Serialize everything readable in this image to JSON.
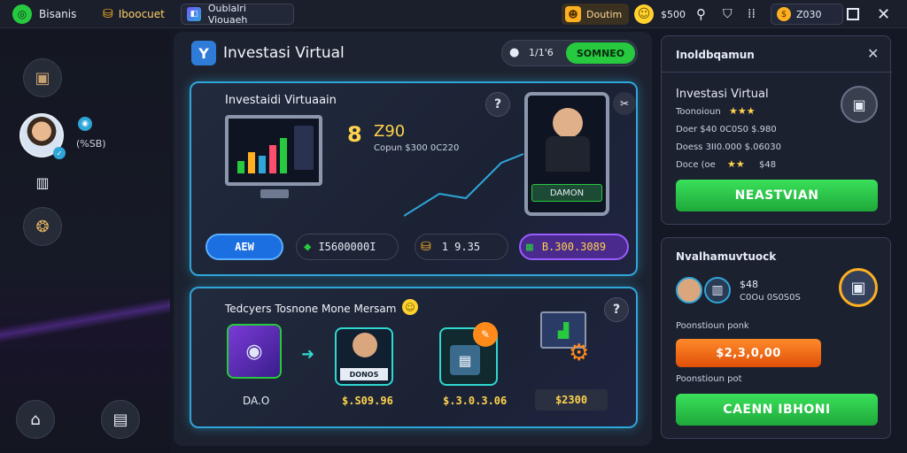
{
  "topbar": {
    "brand_label": "Bisanis",
    "tab2_label": "Iboocuet",
    "window_label": "Oublalri Viouaeh",
    "coin_label": "Doutim",
    "stat_value": "$500",
    "gold_value": "Z030"
  },
  "sidebar": {
    "user_stat": "(%SB)"
  },
  "header": {
    "title": "Investasi Virtual",
    "counter": "1/1'6",
    "status_label": "SOMNEO"
  },
  "featured": {
    "title": "Investaidi Virtuaain",
    "score": "Z90",
    "sub": "Copun $300 0C220",
    "card_label": "DAMON",
    "actions": {
      "add_label": "AEW",
      "balance": "I5600000I",
      "coins": "1 9.35",
      "total": "B.300.3089"
    }
  },
  "market": {
    "title": "Tedcyers Tosnone Mone Mersam",
    "items": [
      {
        "label": "DA.O",
        "price": ""
      },
      {
        "label": "DONOS",
        "price": "$.S09.96"
      },
      {
        "label": "",
        "price": "$.3.0.3.06"
      },
      {
        "label": "",
        "price": "$2300"
      }
    ]
  },
  "right_top": {
    "header": "Inoldbqamun",
    "title": "Investasi Virtual",
    "line1": "Toonoioun",
    "line2": "Doer $40 0C0S0 $.980",
    "line3": "Doess 3II0.000 $.06030",
    "line4": "Doce (oe",
    "line4_value": "$48",
    "button_label": "NEASTVIAN"
  },
  "right_bottom": {
    "header": "Nvalhamuvtuock",
    "stat": "$48",
    "stat_sub": "C0Ou 0S0S0S",
    "section1": "Poonstioun ponk",
    "price_button": "$2,3,0,00",
    "section2": "Poonstioun pot",
    "claim_button": "CAENN IBHONI"
  },
  "colors": {
    "accent_blue": "#2fa6d8",
    "green": "#27c93f",
    "orange": "#ff6a1a",
    "purple": "#7a3bd6",
    "gold": "#ffd34d"
  }
}
